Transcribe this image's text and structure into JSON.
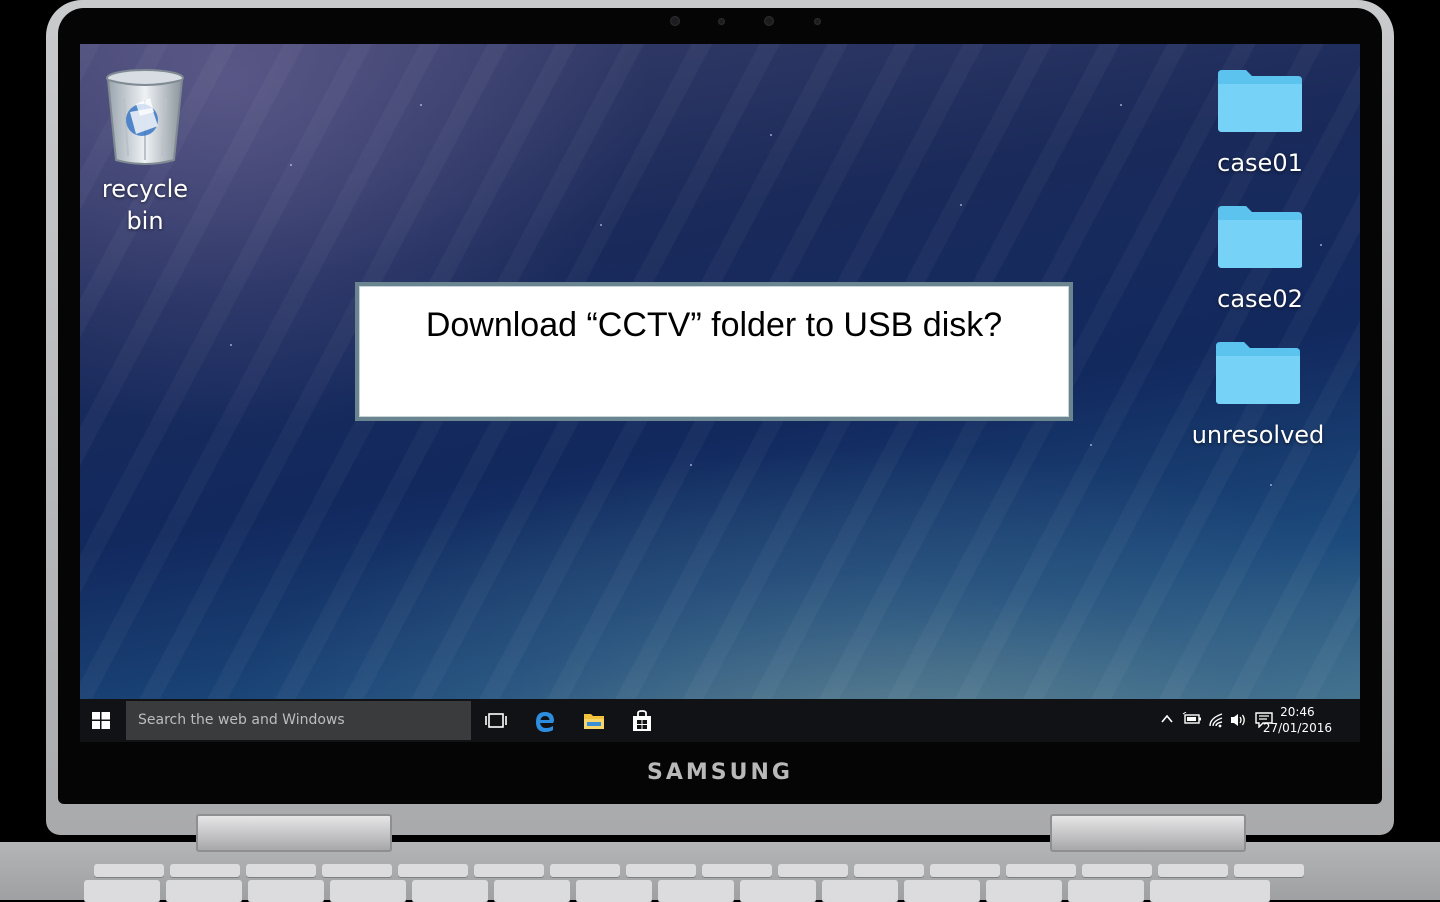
{
  "device": {
    "brand": "SAMSUNG"
  },
  "desktop": {
    "icons": [
      {
        "label_line1": "recycle",
        "label_line2": "bin",
        "icon": "recycle-bin-icon"
      },
      {
        "label": "case01",
        "icon": "folder-icon"
      },
      {
        "label": "case02",
        "icon": "folder-icon"
      },
      {
        "label": "unresolved",
        "icon": "folder-icon"
      }
    ]
  },
  "dialog": {
    "message": "Download “CCTV” folder to USB disk?"
  },
  "taskbar": {
    "search_placeholder": "Search the web and Windows",
    "pinned": [
      "task-view-icon",
      "edge-icon",
      "file-explorer-icon",
      "store-icon"
    ],
    "tray": [
      "chevron-up-icon",
      "battery-icon",
      "wifi-icon",
      "volume-icon",
      "notification-icon"
    ],
    "time": "20:46",
    "date": "27/01/2016"
  },
  "colors": {
    "folder": "#6fd0f6",
    "dialog_border": "#6b8590",
    "taskbar": "#111215",
    "search_box": "#3a3b3d",
    "edge": "#2d8ee0"
  }
}
